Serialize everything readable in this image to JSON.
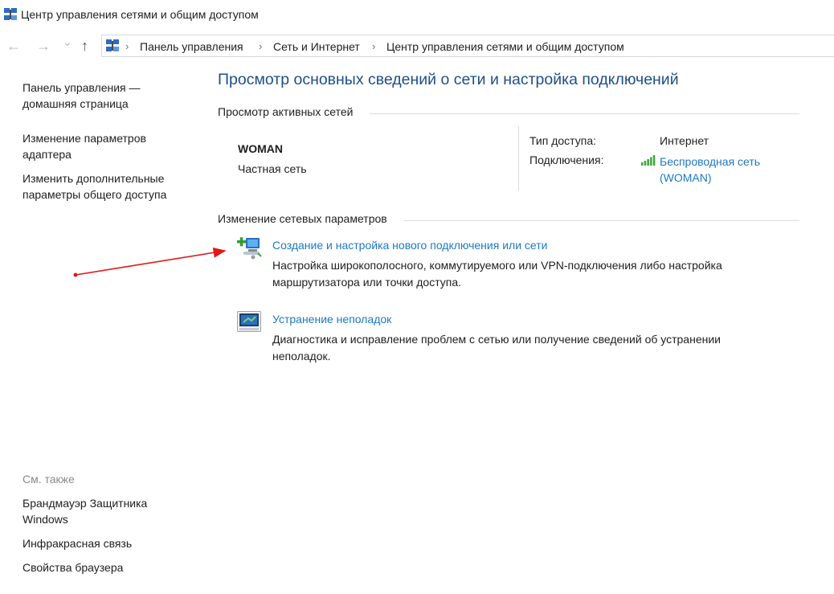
{
  "window": {
    "title": "Центр управления сетями и общим доступом"
  },
  "nav": {
    "back_icon": "←",
    "forward_icon": "→",
    "dropdown_icon": "⌄",
    "up_icon": "↑",
    "breadcrumb": [
      "Панель управления",
      "Сеть и Интернет",
      "Центр управления сетями и общим доступом"
    ],
    "separator": "›"
  },
  "sidebar": {
    "items": [
      {
        "line1": "Панель управления —",
        "line2": "домашняя страница"
      },
      {
        "line1": "Изменение параметров",
        "line2": "адаптера"
      },
      {
        "line1": "Изменить дополнительные",
        "line2": "параметры общего доступа"
      }
    ],
    "see_also_label": "См. также",
    "see_also": [
      {
        "line1": "Брандмауэр Защитника",
        "line2": "Windows"
      },
      {
        "line1": "Инфракрасная связь",
        "line2": ""
      },
      {
        "line1": "Свойства браузера",
        "line2": ""
      }
    ]
  },
  "main": {
    "title": "Просмотр основных сведений о сети и настройка подключений",
    "active_networks_heading": "Просмотр активных сетей",
    "network": {
      "name": "WOMAN",
      "type": "Частная сеть",
      "access_label": "Тип доступа:",
      "access_value": "Интернет",
      "connections_label": "Подключения:",
      "connection_line1": "Беспроводная сеть",
      "connection_line2": "(WOMAN)"
    },
    "change_heading": "Изменение сетевых параметров",
    "tasks": [
      {
        "title": "Создание и настройка нового подключения или сети",
        "desc1": "Настройка широкополосного, коммутируемого или VPN-подключения либо настройка",
        "desc2": "маршрутизатора или точки доступа."
      },
      {
        "title": "Устранение неполадок",
        "desc1": "Диагностика и исправление проблем с сетью или получение сведений об устранении",
        "desc2": "неполадок."
      }
    ]
  },
  "colors": {
    "title_blue": "#1d4f8a",
    "link_blue": "#1c79c4",
    "annotation_arrow": "#e0191b",
    "signal_green": "#3aa63a"
  }
}
